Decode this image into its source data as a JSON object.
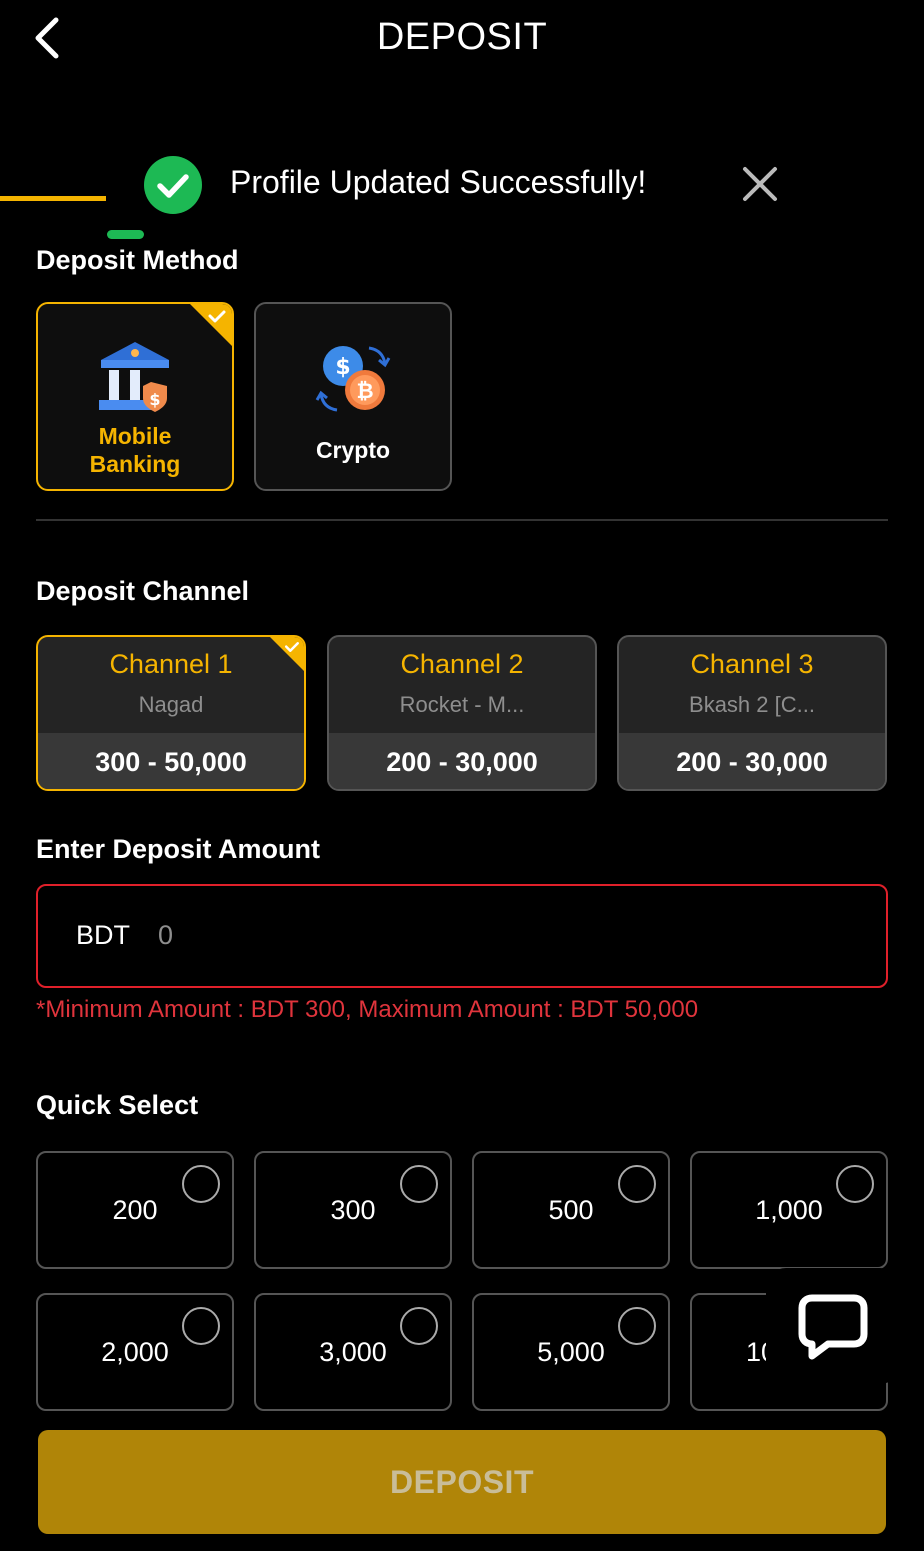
{
  "header": {
    "title": "DEPOSIT"
  },
  "toast": {
    "message": "Profile Updated Successfully!"
  },
  "deposit_method": {
    "label": "Deposit Method",
    "options": [
      {
        "line1": "Mobile",
        "line2": "Banking",
        "selected": true
      },
      {
        "line1": "Crypto",
        "line2": "",
        "selected": false
      }
    ]
  },
  "deposit_channel": {
    "label": "Deposit Channel",
    "channels": [
      {
        "name": "Channel 1",
        "sub": "Nagad",
        "range": "300 - 50,000",
        "selected": true
      },
      {
        "name": "Channel 2",
        "sub": "Rocket - M...",
        "range": "200 - 30,000",
        "selected": false
      },
      {
        "name": "Channel 3",
        "sub": "Bkash 2 [C...",
        "range": "200 - 30,000",
        "selected": false
      }
    ]
  },
  "amount": {
    "label": "Enter Deposit Amount",
    "currency": "BDT",
    "value": "0",
    "hint": "*Minimum Amount : BDT 300, Maximum Amount : BDT 50,000"
  },
  "quick_select": {
    "label": "Quick Select",
    "options": [
      "200",
      "300",
      "500",
      "1,000",
      "2,000",
      "3,000",
      "5,000",
      "10"
    ]
  },
  "deposit_button": {
    "label": "DEPOSIT"
  },
  "colors": {
    "accent": "#f5b400",
    "success": "#1db954",
    "error": "#e0343c",
    "button": "#b08508"
  }
}
